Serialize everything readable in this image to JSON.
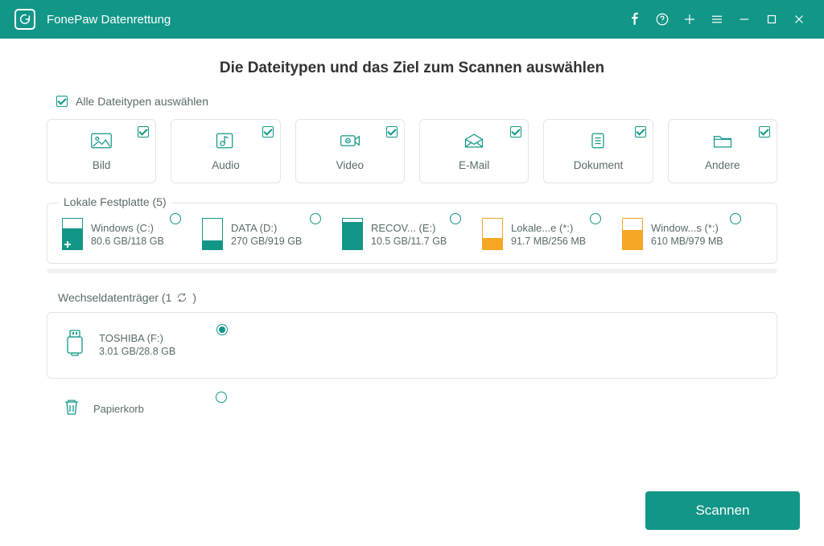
{
  "app": {
    "title": "FonePaw Datenrettung"
  },
  "colors": {
    "accent": "#119688",
    "warn": "#f5a623"
  },
  "page": {
    "heading": "Die Dateitypen und das Ziel zum Scannen auswählen",
    "select_all_label": "Alle Dateitypen auswählen",
    "select_all_checked": true
  },
  "types": [
    {
      "id": "image",
      "label": "Bild",
      "checked": true,
      "icon": "image-icon"
    },
    {
      "id": "audio",
      "label": "Audio",
      "checked": true,
      "icon": "audio-icon"
    },
    {
      "id": "video",
      "label": "Video",
      "checked": true,
      "icon": "video-icon"
    },
    {
      "id": "email",
      "label": "E-Mail",
      "checked": true,
      "icon": "email-icon"
    },
    {
      "id": "document",
      "label": "Dokument",
      "checked": true,
      "icon": "document-icon"
    },
    {
      "id": "other",
      "label": "Andere",
      "checked": true,
      "icon": "folder-icon"
    }
  ],
  "local_group": {
    "legend": "Lokale Festplatte (5)",
    "drives": [
      {
        "name": "Windows (C:)",
        "size": "80.6 GB/118 GB",
        "fill_pct": 68,
        "color": "teal",
        "is_windows": true,
        "selected": false
      },
      {
        "name": "DATA (D:)",
        "size": "270 GB/919 GB",
        "fill_pct": 29,
        "color": "teal",
        "is_windows": false,
        "selected": false
      },
      {
        "name": "RECOV... (E:)",
        "size": "10.5 GB/11.7 GB",
        "fill_pct": 90,
        "color": "teal",
        "is_windows": false,
        "selected": false
      },
      {
        "name": "Lokale...e (*:)",
        "size": "91.7 MB/256 MB",
        "fill_pct": 36,
        "color": "orange",
        "is_windows": false,
        "selected": false
      },
      {
        "name": "Window...s (*:)",
        "size": "610 MB/979 MB",
        "fill_pct": 62,
        "color": "orange",
        "is_windows": false,
        "selected": false
      }
    ]
  },
  "removable_group": {
    "legend_prefix": "Wechseldatenträger (1",
    "legend_suffix": ")",
    "drives": [
      {
        "name": "TOSHIBA (F:)",
        "size": "3.01 GB/28.8 GB",
        "selected": true
      }
    ]
  },
  "recycle": {
    "label": "Papierkorb",
    "selected": false
  },
  "actions": {
    "scan_label": "Scannen"
  }
}
